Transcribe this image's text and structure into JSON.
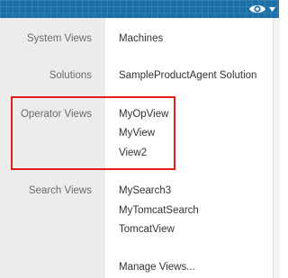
{
  "header": {
    "icon": "eye-icon",
    "dropdown_icon": "caret-down-icon"
  },
  "sections": {
    "system_views": {
      "label": "System Views",
      "items": [
        "Machines"
      ]
    },
    "solutions": {
      "label": "Solutions",
      "items": [
        "SampleProductAgent Solution"
      ]
    },
    "operator_views": {
      "label": "Operator Views",
      "items": [
        "MyOpView",
        "MyView",
        "View2"
      ]
    },
    "search_views": {
      "label": "Search Views",
      "items": [
        "MySearch3",
        "MyTomcatSearch",
        "TomcatView"
      ]
    }
  },
  "footer": {
    "manage_views": "Manage Views..."
  },
  "colors": {
    "topbar": "#1d6fa8",
    "label_column": "#ececec",
    "highlight": "#e02020"
  }
}
